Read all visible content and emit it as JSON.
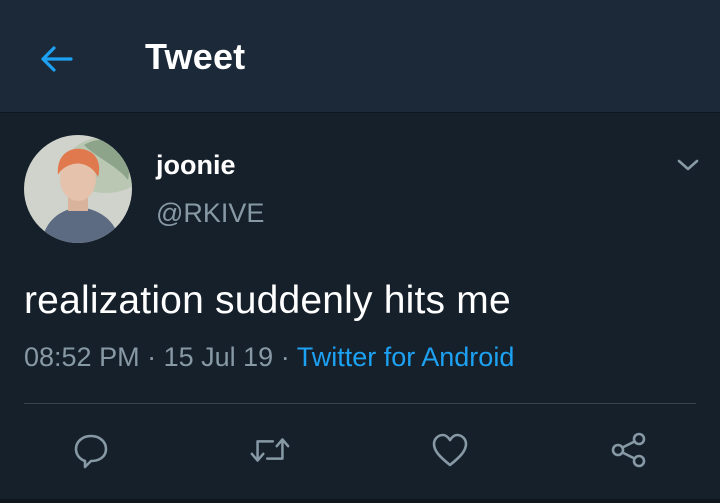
{
  "header": {
    "title": "Tweet",
    "back_icon": "arrow-left-icon",
    "accent": "#1da1f2"
  },
  "tweet": {
    "author_name": "joonie",
    "author_handle": "@RKIVE",
    "text": "realization suddenly hits me",
    "time": "08:52 PM",
    "date": "15 Jul 19",
    "source": "Twitter for Android",
    "separator": "·"
  },
  "actions": {
    "reply_icon": "reply-icon",
    "retweet_icon": "retweet-icon",
    "like_icon": "heart-icon",
    "share_icon": "share-icon"
  },
  "colors": {
    "background": "#15202b",
    "header_bg": "#1c2938",
    "text_primary": "#ffffff",
    "text_secondary": "#8899a6",
    "link": "#1da1f2"
  }
}
